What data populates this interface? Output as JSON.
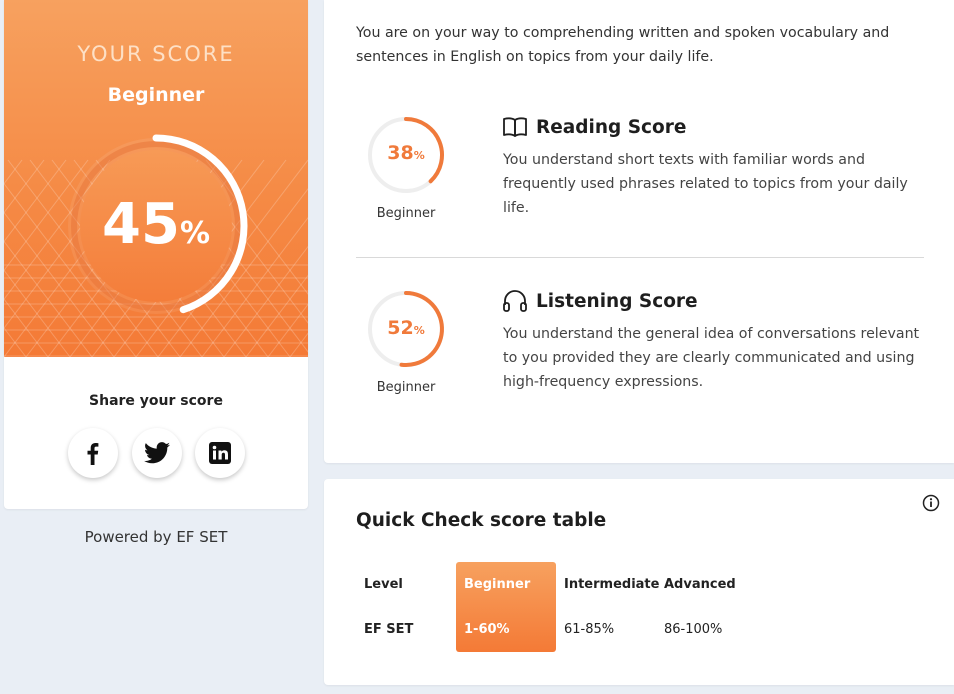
{
  "score_card": {
    "title": "YOUR SCORE",
    "level": "Beginner",
    "score": "45",
    "score_unit": "%",
    "score_fraction": 0.45,
    "share_label": "Share your score",
    "social": [
      "facebook-icon",
      "twitter-icon",
      "linkedin-icon"
    ]
  },
  "powered_by": "Powered by EF SET",
  "details": {
    "intro": "You are on your way to comprehending written and spoken vocabulary and sentences in English on topics from your daily life.",
    "reading": {
      "title": "Reading Score",
      "score": "38",
      "unit": "%",
      "fraction": 0.38,
      "level": "Beginner",
      "description": "You understand short texts with familiar words and frequently used phrases related to topics from your daily life.",
      "icon": "book-icon"
    },
    "listening": {
      "title": "Listening Score",
      "score": "52",
      "unit": "%",
      "fraction": 0.52,
      "level": "Beginner",
      "description": "You understand the general idea of conversations relevant to you provided they are clearly communicated and using high-frequency expressions.",
      "icon": "headphones-icon"
    }
  },
  "score_table": {
    "title": "Quick Check score table",
    "row_headers": [
      "Level",
      "EF SET"
    ],
    "columns": [
      {
        "level": "Beginner",
        "range": "1-60%"
      },
      {
        "level": "Intermediate",
        "range": "61-85%"
      },
      {
        "level": "Advanced",
        "range": "86-100%"
      }
    ],
    "highlight": "Beginner"
  },
  "colors": {
    "accent": "#f47a36",
    "accent_light": "#f7a15f",
    "background": "#e9eef5"
  }
}
